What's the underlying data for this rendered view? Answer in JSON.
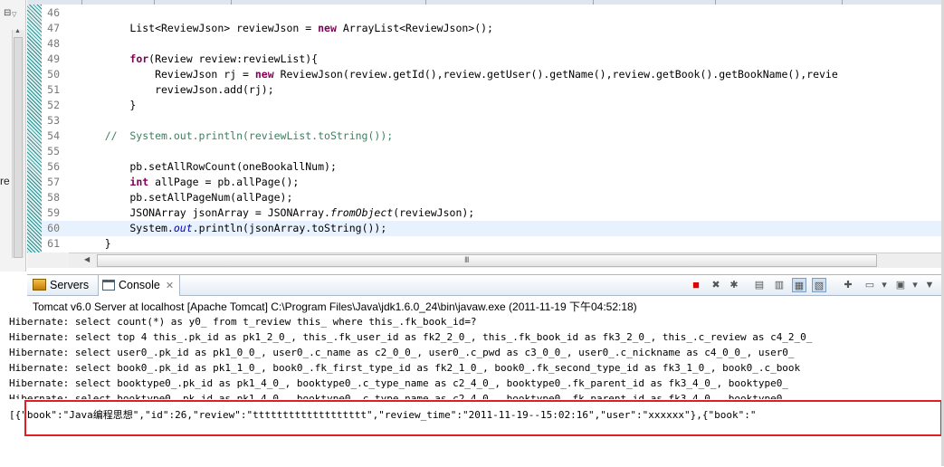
{
  "left_panel": {
    "icon": "⊟",
    "arrow": "▽",
    "text_fragment": "re"
  },
  "editor": {
    "lines": [
      {
        "no": "46",
        "code": ""
      },
      {
        "no": "47",
        "code": "        List<ReviewJson> reviewJson = new ArrayList<ReviewJson>();"
      },
      {
        "no": "48",
        "code": ""
      },
      {
        "no": "49",
        "code": "        for(Review review:reviewList){"
      },
      {
        "no": "50",
        "code": "            ReviewJson rj = new ReviewJson(review.getId(),review.getUser().getName(),review.getBook().getBookName(),revie"
      },
      {
        "no": "51",
        "code": "            reviewJson.add(rj);"
      },
      {
        "no": "52",
        "code": "        }"
      },
      {
        "no": "53",
        "code": ""
      },
      {
        "no": "54",
        "code": "    //  System.out.println(reviewList.toString());"
      },
      {
        "no": "55",
        "code": ""
      },
      {
        "no": "56",
        "code": "        pb.setAllRowCount(oneBookallNum);"
      },
      {
        "no": "57",
        "code": "        int allPage = pb.allPage();"
      },
      {
        "no": "58",
        "code": "        pb.setAllPageNum(allPage);"
      },
      {
        "no": "59",
        "code": "        JSONArray jsonArray = JSONArray.fromObject(reviewJson);"
      },
      {
        "no": "60",
        "code": "        System.out.println(jsonArray.toString());"
      },
      {
        "no": "61",
        "code": "    }"
      }
    ],
    "current_line": "60"
  },
  "console": {
    "tabs": [
      {
        "label": "Servers",
        "icon": "servers-icon"
      },
      {
        "label": "Console",
        "icon": "console-icon",
        "active": true
      }
    ],
    "process_label": "Tomcat v6.0 Server at localhost [Apache Tomcat] C:\\Program Files\\Java\\jdk1.6.0_24\\bin\\javaw.exe (2011-11-19 下午04:52:18)",
    "output": [
      "Hibernate: select count(*) as y0_ from t_review this_ where this_.fk_book_id=?",
      "Hibernate: select top 4 this_.pk_id as pk1_2_0_, this_.fk_user_id as fk2_2_0_, this_.fk_book_id as fk3_2_0_, this_.c_review as c4_2_0_",
      "Hibernate: select user0_.pk_id as pk1_0_0_, user0_.c_name as c2_0_0_, user0_.c_pwd as c3_0_0_, user0_.c_nickname as c4_0_0_, user0_",
      "Hibernate: select book0_.pk_id as pk1_1_0_, book0_.fk_first_type_id as fk2_1_0_, book0_.fk_second_type_id as fk3_1_0_, book0_.c_book",
      "Hibernate: select booktype0_.pk_id as pk1_4_0_, booktype0_.c_type_name as c2_4_0_, booktype0_.fk_parent_id as fk3_4_0_, booktype0_",
      "Hibernate: select booktype0_.pk_id as pk1_4_0_, booktype0_.c_type_name as c2_4_0_, booktype0_.fk_parent_id as fk3_4_0_, booktype0_",
      "[{\"book\":\"Java编程思想\",\"id\":26,\"review\":\"ttttttttttttttttttt\",\"review_time\":\"2011-11-19--15:02:16\",\"user\":\"xxxxxx\"},{\"book\":\""
    ],
    "highlight_color": "#e02020"
  },
  "toolbar_icons": [
    "terminate-icon",
    "remove-launch-icon",
    "remove-all-icon",
    "clear-console-icon",
    "scroll-lock-icon",
    "word-wrap-icon",
    "show-on-output-icon",
    "pin-console-icon",
    "display-selected-icon",
    "dropdown-icon",
    "open-console-icon",
    "dropdown-icon",
    "view-menu-icon"
  ]
}
